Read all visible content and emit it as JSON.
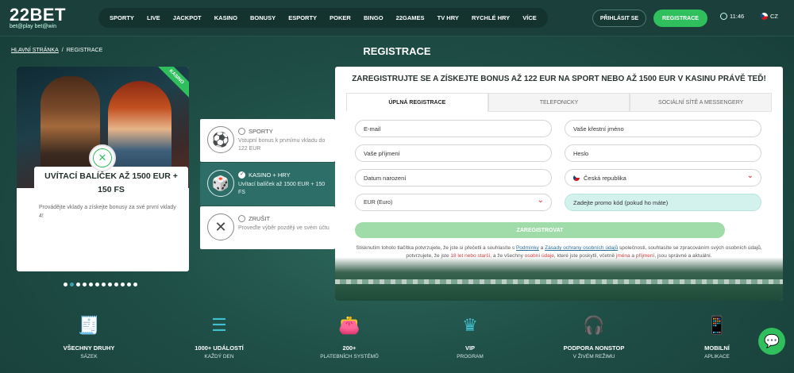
{
  "header": {
    "logo_main": "22BET",
    "logo_sub": "bet@play bet@win",
    "nav": [
      "SPORTY",
      "LIVE",
      "JACKPOT",
      "KASINO",
      "BONUSY",
      "ESPORTY",
      "POKER",
      "BINGO",
      "22GAMES",
      "TV HRY",
      "RYCHLÉ HRY",
      "VÍCE"
    ],
    "login_label": "PŘIHLÁSIT SE",
    "register_label": "REGISTRACE",
    "time": "11:46",
    "language": "CZ"
  },
  "breadcrumb": {
    "home": "HLAVNÍ STRÁNKA",
    "separator": "/",
    "current": "REGISTRACE"
  },
  "page_title": "REGISTRACE",
  "bonus_card": {
    "ribbon": "KASINO",
    "title": "UVÍTACÍ BALÍČEK AŽ 1500 EUR + 150 FS",
    "text": "Provádějte vklady a získejte bonusy za své první vklady 4!"
  },
  "bonus_options": [
    {
      "title": "SPORTY",
      "desc": "Vstupní bonus k prvnímu vkladu do 122 EUR",
      "icon": "soccer-ball-icon",
      "active": false
    },
    {
      "title": "KASINO + HRY",
      "desc": "Uvítací balíček až 1500 EUR + 150 FS",
      "icon": "casino-chips-icon",
      "active": true
    },
    {
      "title": "ZRUŠIT",
      "desc": "Proveďte výběr později ve svém účtu",
      "icon": "cancel-icon",
      "active": false
    }
  ],
  "slider_dots": {
    "count": 12,
    "active_index": 1
  },
  "registration": {
    "headline": "ZAREGISTRUJTE SE A ZÍSKEJTE BONUS AŽ 122 EUR NA SPORT NEBO AŽ 1500 EUR V KASINU PRÁVĚ TEĎ!",
    "tabs": [
      "ÚPLNÁ REGISTRACE",
      "TELEFONICKY",
      "SOCIÁLNÍ SÍTĚ A MESSENGERY"
    ],
    "fields": {
      "email": "E-mail",
      "first_name": "Vaše křestní jméno",
      "last_name": "Vaše příjmení",
      "password": "Heslo",
      "birth_date": "Datum narození",
      "country": "Česká republika",
      "currency": "EUR (Euro)",
      "promo": "Zadejte promo kód (pokud ho máte)"
    },
    "submit_label": "ZAREGISTROVAT",
    "terms": {
      "t1": "Stisknutím tohoto tlačítka potvrzujete, že jste si přečetli a souhlasíte s ",
      "l1": "Podmínky",
      "t2": " a ",
      "l2": "Zásady ochrany osobních údajů",
      "t3": " společnosti, souhlasíte se zpracováním svých osobních údajů, potvrzujete, že jste ",
      "r1": "18 let nebo starší",
      "t4": ", a že všechny ",
      "r2": "osobní údaje",
      "t5": ", které jste poskytli, včetně ",
      "r3": "jména",
      "t6": " a ",
      "r4": "příjmení",
      "t7": ", jsou správné a aktuální."
    }
  },
  "features": [
    {
      "title": "VŠECHNY DRUHY",
      "subtitle": "SÁZEK",
      "icon": "betslip-icon"
    },
    {
      "title": "1000+ UDÁLOSTÍ",
      "subtitle": "KAŽDÝ DEN",
      "icon": "list-icon"
    },
    {
      "title": "200+",
      "subtitle": "PLATEBNÍCH SYSTÉMŮ",
      "icon": "wallet-icon"
    },
    {
      "title": "VIP",
      "subtitle": "PROGRAM",
      "icon": "crown-icon"
    },
    {
      "title": "PODPORA NONSTOP",
      "subtitle": "V ŽIVÉM REŽIMU",
      "icon": "headset-icon"
    },
    {
      "title": "MOBILNÍ",
      "subtitle": "APLIKACE",
      "icon": "mobile-icon"
    }
  ],
  "colors": {
    "accent_green": "#2fbf5d",
    "header_bg": "#1b403b",
    "teal_active": "#2d6e68",
    "icon_blue": "#3fbfd0"
  }
}
